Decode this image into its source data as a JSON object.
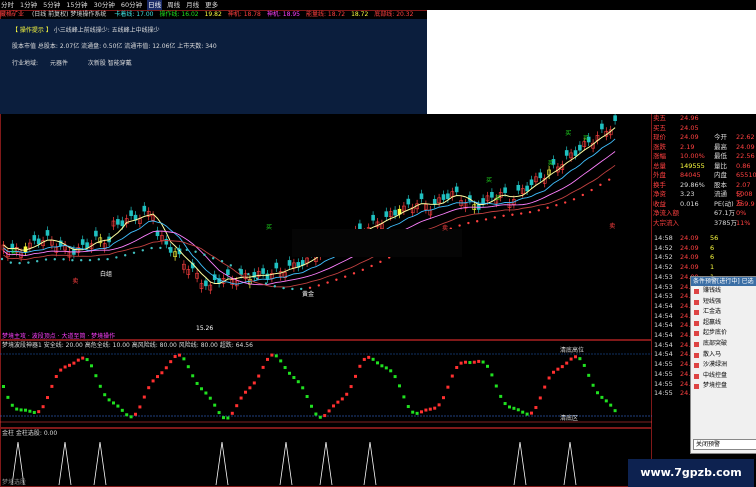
{
  "toolbar": {
    "tabs": [
      {
        "label": "分时",
        "active": false
      },
      {
        "label": "1分钟",
        "active": false
      },
      {
        "label": "5分钟",
        "active": false
      },
      {
        "label": "15分钟",
        "active": false
      },
      {
        "label": "30分钟",
        "active": false
      },
      {
        "label": "60分钟",
        "active": false
      },
      {
        "label": "日线",
        "active": true
      },
      {
        "label": "周线",
        "active": false
      },
      {
        "label": "月线",
        "active": false
      },
      {
        "label": "更多",
        "active": false
      }
    ]
  },
  "main_info": {
    "stock": "藏格矿业",
    "formula": "(日线 前复权) 梦境操作系统",
    "items": [
      "卡着线: 17.00",
      "操作线: 16.02",
      "19.82",
      "神机: 18.78",
      "神机: 18.95",
      "能量线: 18.72",
      "18.72",
      "底部线: 20.32"
    ]
  },
  "overlay": {
    "title": "【 操作提示 】",
    "hint": "小三线峰上前线操少: 五线峰上中线操少",
    "capital": "股本市值  总股本: 2.07亿 流通盘: 0.50亿 流通市值: 12.06亿 上市天数: 340",
    "industry_label": "行业地域:",
    "industry": "元器件",
    "concept": "次新股 智能穿戴"
  },
  "main_chart_labels": {
    "buy": "买",
    "sell": "卖",
    "s1": "白组",
    "s2": "黄金",
    "low_price": "15.26",
    "bottom_note": "梦境主攻 · 波段顶点 · 大道至简 · 梦境操作"
  },
  "indicator": {
    "header": "梦境波段神器1  安全线: 20.00  高危全线: 10.00  高风险线: 80.00  风险线: 80.00  超跌: 64.56",
    "label_top": "清底高位",
    "label_bottom": "清底区"
  },
  "volume": {
    "header": "金柱  金柱选股: 0.00",
    "footer": "梦境选股"
  },
  "quote_panel": {
    "rows": [
      {
        "l": "卖五",
        "v": "24.96",
        "c": "red",
        "n": ""
      },
      {
        "l": "买五",
        "v": "24.05",
        "c": "red",
        "n": ""
      },
      {
        "l": "现价",
        "v": "24.09",
        "c": "red",
        "l2": "今开",
        "v2": "22.62"
      },
      {
        "l": "涨跌",
        "v": "2.19",
        "c": "red",
        "l2": "最高",
        "v2": "24.09"
      },
      {
        "l": "涨幅",
        "v": "10.00%",
        "c": "red",
        "l2": "最低",
        "v2": "22.56"
      },
      {
        "l": "总量",
        "v": "149555",
        "c": "yel",
        "l2": "量比",
        "v2": "0.86"
      },
      {
        "l": "外盘",
        "v": "84045",
        "c": "red",
        "l2": "内盘",
        "v2": "65510"
      },
      {
        "l": "换手",
        "v": "29.86%",
        "c": "wht",
        "l2": "股本",
        "v2": "2.07亿"
      },
      {
        "l": "净资",
        "v": "3.23",
        "c": "wht",
        "l2": "流通",
        "v2": "5008万"
      },
      {
        "l": "收益",
        "v": "0.016",
        "c": "wht",
        "l2": "PE(动)",
        "v2": "369.9"
      },
      {
        "l": "净流入额",
        "v": "",
        "c": "red",
        "l2": "67.1万",
        "v2": "0%"
      },
      {
        "l": "大宗流入",
        "v": "",
        "c": "red",
        "l2": "3785万",
        "v2": "11%"
      }
    ],
    "ticks": [
      {
        "t": "14:58",
        "p": "24.09",
        "v": "56"
      },
      {
        "t": "14:52",
        "p": "24.09",
        "v": "6"
      },
      {
        "t": "14:52",
        "p": "24.09",
        "v": "6"
      },
      {
        "t": "14:52",
        "p": "24.09",
        "v": "1"
      },
      {
        "t": "14:53",
        "p": "24.09",
        "v": "1"
      },
      {
        "t": "14:53",
        "p": "24.09",
        "v": ""
      },
      {
        "t": "14:53",
        "p": "24.09",
        "v": ""
      },
      {
        "t": "14:54",
        "p": "24.09",
        "v": ""
      },
      {
        "t": "14:54",
        "p": "24.09",
        "v": ""
      },
      {
        "t": "14:54",
        "p": "24.09",
        "v": ""
      },
      {
        "t": "14:54",
        "p": "24.09",
        "v": ""
      },
      {
        "t": "14:54",
        "p": "24.09",
        "v": ""
      },
      {
        "t": "14:54",
        "p": "24.09",
        "v": ""
      },
      {
        "t": "14:55",
        "p": "24.09",
        "v": "108"
      },
      {
        "t": "14:55",
        "p": "24.09",
        "v": "10"
      },
      {
        "t": "14:55",
        "p": "24.09",
        "v": ""
      },
      {
        "t": "14:55",
        "p": "24.09",
        "v": ""
      }
    ]
  },
  "popup": {
    "title": "条件预警[进行中] 已选股",
    "items": [
      "赚钱线",
      "短线强",
      "汇金选",
      "超赢线",
      "起步底价",
      "底部突破",
      "散入马",
      "沙漠绿洲",
      "中线控盘",
      "梦境控盘"
    ],
    "footer": "关闭预警"
  },
  "watermark": "www.7gpzb.com"
}
